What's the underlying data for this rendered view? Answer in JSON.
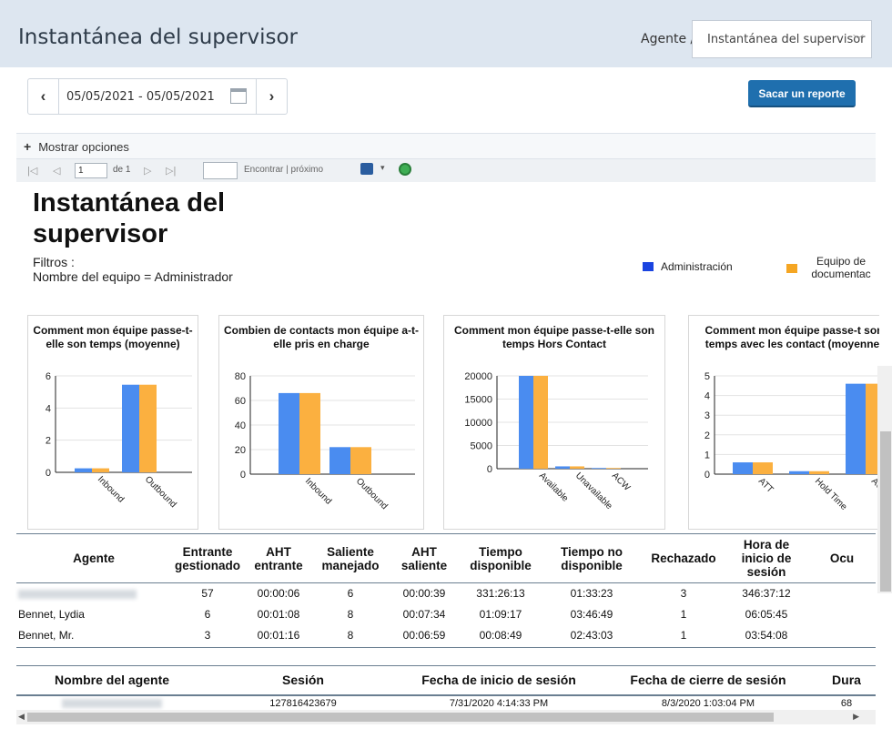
{
  "header": {
    "title": "Instantánea del supervisor",
    "crumb": "Agente /",
    "crumb_select": "Instantánea del supervisor"
  },
  "toolbar": {
    "date_range": "05/05/2021 - 05/05/2021",
    "report_button": "Sacar un reporte"
  },
  "options": {
    "plus": "+",
    "label": "Mostrar opciones"
  },
  "pager": {
    "page": "1",
    "of": "de 1",
    "find": "Encontrar | próximo"
  },
  "report": {
    "title": "Instantánea del supervisor",
    "filters_label": "Filtros :",
    "filters_value": "Nombre del equipo = Administrador",
    "legend": [
      {
        "name": "Administración",
        "color": "#1a44e0"
      },
      {
        "name": "Equipo de documentac",
        "color": "#f5a623"
      }
    ]
  },
  "colors": {
    "series_a": "#4a8cf0",
    "series_b": "#fbb040"
  },
  "chart_data": [
    {
      "type": "bar",
      "title": "Comment mon équipe passe-t-elle son temps (moyenne)",
      "categories": [
        "Inbound",
        "Outbound"
      ],
      "series": [
        {
          "values": [
            0.25,
            5.45
          ]
        },
        {
          "values": [
            0.25,
            5.45
          ]
        }
      ],
      "ylim": [
        0,
        6
      ],
      "yticks": [
        "0",
        "2",
        "4",
        "6"
      ]
    },
    {
      "type": "bar",
      "title": "Combien de contacts mon équipe a-t-elle pris en charge",
      "categories": [
        "Inbound",
        "Outbound"
      ],
      "series": [
        {
          "values": [
            66,
            22
          ]
        },
        {
          "values": [
            66,
            22
          ]
        }
      ],
      "ylim": [
        0,
        80
      ],
      "yticks": [
        "0",
        "20",
        "40",
        "60",
        "80"
      ]
    },
    {
      "type": "bar",
      "title": "Comment mon équipe passe-t-elle son temps Hors Contact",
      "categories": [
        "Available",
        "Unavailable",
        "ACW"
      ],
      "series": [
        {
          "values": [
            20000,
            500,
            150
          ]
        },
        {
          "values": [
            20000,
            500,
            150
          ]
        }
      ],
      "ylim": [
        0,
        20000
      ],
      "yticks": [
        "0",
        "5000",
        "10000",
        "15000",
        "20000"
      ]
    },
    {
      "type": "bar",
      "title": "Comment mon équipe passe-t son temps avec les contact (moyenne)",
      "categories": [
        "ATT",
        "Hold Time",
        "AC"
      ],
      "series": [
        {
          "values": [
            0.6,
            0.15,
            4.6
          ]
        },
        {
          "values": [
            0.6,
            0.15,
            4.6
          ]
        }
      ],
      "ylim": [
        0,
        5
      ],
      "yticks": [
        "0",
        "1",
        "2",
        "3",
        "4",
        "5"
      ]
    }
  ],
  "table1": {
    "headers": [
      "Agente",
      "Entrante gestionado",
      "AHT entrante",
      "Saliente manejado",
      "AHT saliente",
      "Tiempo disponible",
      "Tiempo no disponible",
      "Rechazado",
      "Hora de inicio de sesión",
      "Ocu"
    ],
    "rows": [
      [
        "",
        "57",
        "00:00:06",
        "6",
        "00:00:39",
        "331:26:13",
        "01:33:23",
        "3",
        "346:37:12",
        ""
      ],
      [
        "Bennet, Lydia",
        "6",
        "00:01:08",
        "8",
        "00:07:34",
        "01:09:17",
        "03:46:49",
        "1",
        "06:05:45",
        ""
      ],
      [
        "Bennet, Mr.",
        "3",
        "00:01:16",
        "8",
        "00:06:59",
        "00:08:49",
        "02:43:03",
        "1",
        "03:54:08",
        ""
      ]
    ]
  },
  "table2": {
    "headers": [
      "Nombre del agente",
      "Sesión",
      "Fecha de inicio de sesión",
      "Fecha de cierre de sesión",
      "Dura"
    ],
    "rows": [
      [
        "",
        "127816423679",
        "7/31/2020 4:14:33 PM",
        "8/3/2020 1:03:04 PM",
        "68"
      ]
    ]
  }
}
